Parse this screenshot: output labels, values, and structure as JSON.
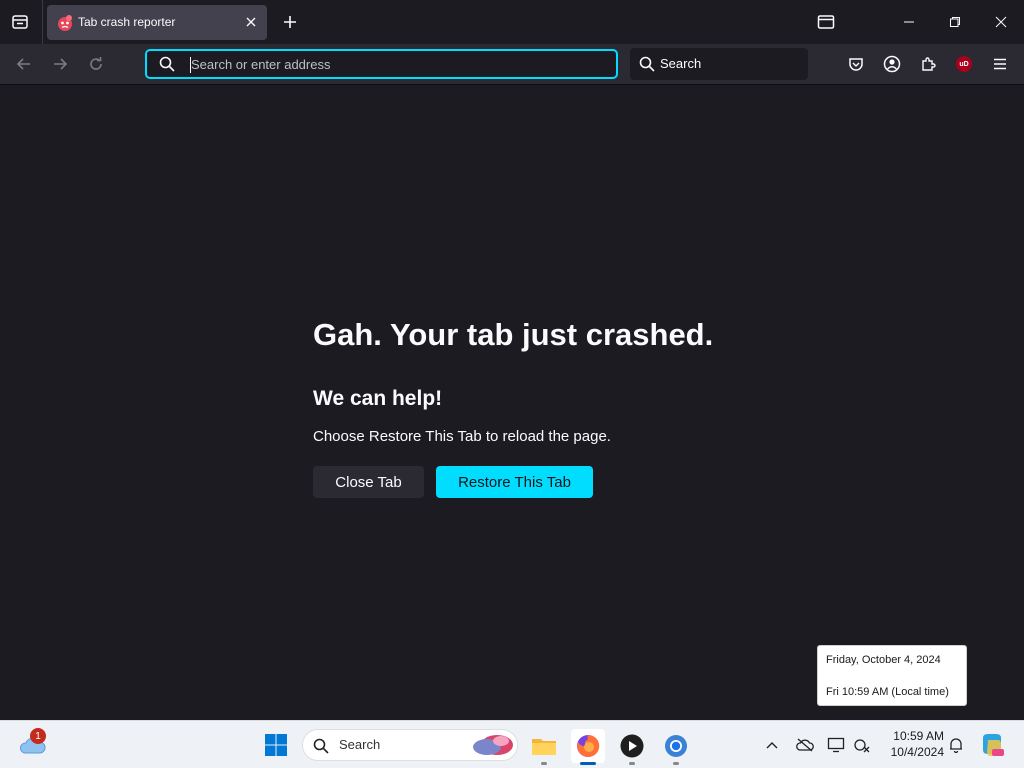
{
  "browser": {
    "tab": {
      "title": "Tab crash reporter"
    },
    "urlbar": {
      "placeholder": "Search or enter address"
    },
    "searchbar": {
      "label": "Search"
    },
    "extensions": {
      "ublock_label": "uD"
    }
  },
  "crash_page": {
    "heading": "Gah. Your tab just crashed.",
    "subheading": "We can help!",
    "message": "Choose Restore This Tab to reload the page.",
    "close_button": "Close Tab",
    "restore_button": "Restore This Tab"
  },
  "tooltip": {
    "date_line": "Friday, October 4, 2024",
    "time_line": "Fri 10:59 AM (Local time)"
  },
  "taskbar": {
    "weather_badge": "1",
    "search_label": "Search",
    "clock_time": "10:59 AM",
    "clock_date": "10/4/2024"
  },
  "colors": {
    "accent": "#00ddff",
    "page_bg": "#1c1b22",
    "toolbar_bg": "#2b2a33"
  }
}
